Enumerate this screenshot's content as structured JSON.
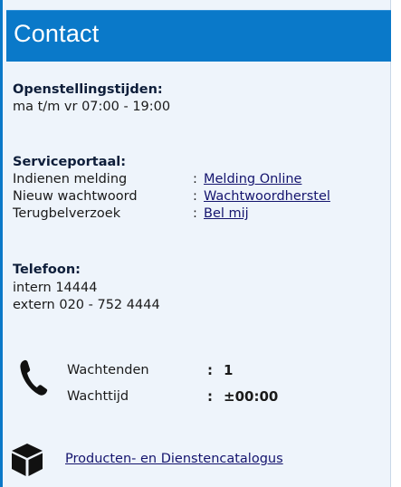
{
  "header": {
    "title": "Contact"
  },
  "hours": {
    "heading": "Openstellingstijden:",
    "value": "ma t/m vr 07:00 - 19:00"
  },
  "service": {
    "heading": "Serviceportaal:",
    "rows": [
      {
        "label": "Indienen melding",
        "sep": ":",
        "link": "Melding Online"
      },
      {
        "label": "Nieuw wachtwoord",
        "sep": ":",
        "link": "Wachtwoordherstel"
      },
      {
        "label": "Terugbelverzoek",
        "sep": ":",
        "link": "Bel mij"
      }
    ]
  },
  "phone": {
    "heading": "Telefoon:",
    "intern": "intern 14444",
    "extern": "extern 020 - 752 4444"
  },
  "queue": {
    "icon": "phone-icon",
    "waiting_label": "Wachtenden",
    "waiting_sep": ":",
    "waiting_value": "1",
    "time_label": "Wachttijd",
    "time_sep": ":",
    "time_value": "±00:00"
  },
  "catalog": {
    "icon": "box-icon",
    "link": "Producten- en Dienstencatalogus"
  },
  "colors": {
    "header": "#0a79c9",
    "panel": "#eef4fb",
    "link": "#14146e"
  }
}
